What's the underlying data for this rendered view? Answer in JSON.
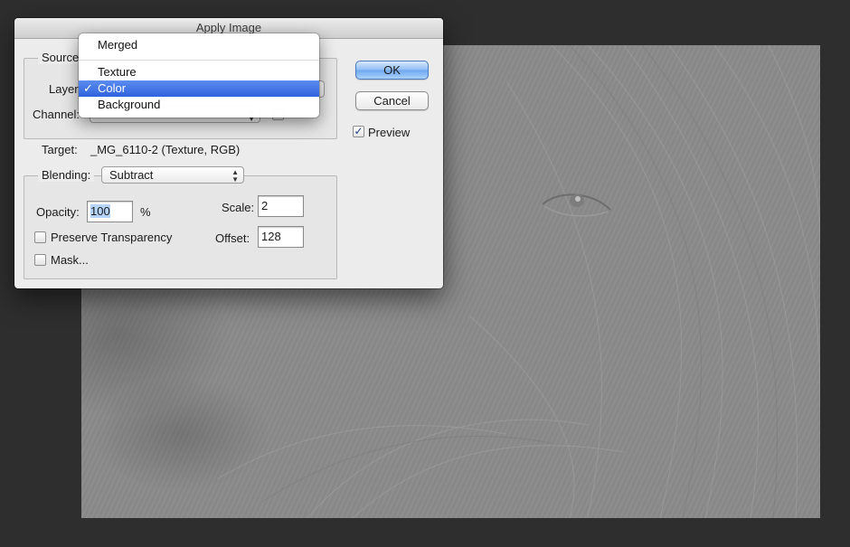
{
  "dialog": {
    "title": "Apply Image",
    "source_label": "Source",
    "layer_label": "Layer:",
    "channel_label": "Channel:",
    "target_label": "Target:",
    "target_value": "_MG_6110-2 (Texture, RGB)",
    "blending_label": "Blending:",
    "blending_value": "Subtract",
    "opacity_label": "Opacity:",
    "opacity_value": "100",
    "opacity_unit": "%",
    "scale_label": "Scale:",
    "scale_value": "2",
    "offset_label": "Offset:",
    "offset_value": "128",
    "preserve_transparency_label": "Preserve Transparency",
    "preserve_transparency_checked": false,
    "mask_label": "Mask...",
    "mask_checked": false
  },
  "buttons": {
    "ok_label": "OK",
    "cancel_label": "Cancel",
    "preview_label": "Preview",
    "preview_checked": true
  },
  "layer_menu": {
    "items": [
      {
        "label": "Merged",
        "selected": false
      },
      {
        "label": "Texture",
        "selected": false
      },
      {
        "label": "Color",
        "selected": true
      },
      {
        "label": "Background",
        "selected": false
      }
    ],
    "check_glyph": "✓"
  },
  "icons": {
    "checkmark": "checkmark-icon",
    "popup_arrows": "up-down-arrows-icon"
  },
  "colors": {
    "selection_highlight": "#2f63de",
    "default_button": "#6ea7ef",
    "canvas_gray": "#8b8b8b",
    "workspace": "#2e2e2e"
  }
}
